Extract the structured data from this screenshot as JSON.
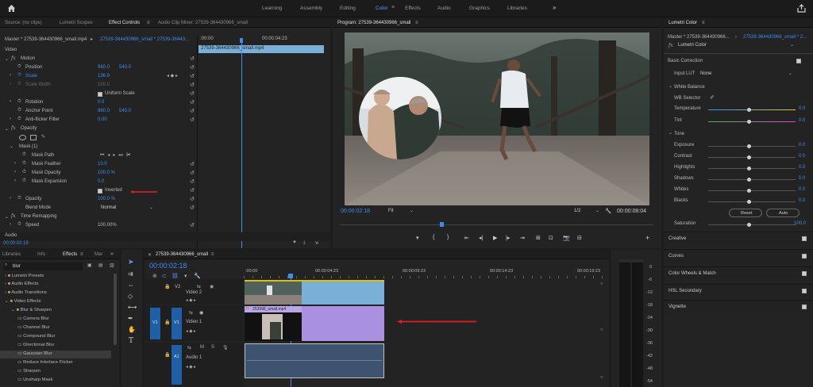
{
  "workspaces": [
    "Learning",
    "Assembly",
    "Editing",
    "Color",
    "Effects",
    "Audio",
    "Graphics",
    "Libraries"
  ],
  "active_workspace": "Color",
  "source_tabs": {
    "source": "Source: (no clips)",
    "lumetri_scopes": "Lumetri Scopes",
    "effect_controls": "Effect Controls",
    "audio_mixer": "Audio Clip Mixer: 27539-364430966_small"
  },
  "effect_controls": {
    "master": "Master * 27539-364430966_small.mp4",
    "clip": "27539-364430966_small * 27539-36443...",
    "ruler_start": ":00:00",
    "ruler_end": "00:00:04:23",
    "clip_bar": "27539-364430966_small.mp4",
    "video_label": "Video",
    "motion": "Motion",
    "position": {
      "label": "Position",
      "x": "960.0",
      "y": "540.0"
    },
    "scale": {
      "label": "Scale",
      "value": "136.9"
    },
    "scale_width": {
      "label": "Scale Width",
      "value": "100.0"
    },
    "uniform_scale": "Uniform Scale",
    "rotation": {
      "label": "Rotation",
      "value": "0.0"
    },
    "anchor": {
      "label": "Anchor Point",
      "x": "960.0",
      "y": "540.0"
    },
    "anti_flicker": {
      "label": "Anti-flicker Filter",
      "value": "0.00"
    },
    "opacity": "Opacity",
    "mask": "Mask (1)",
    "mask_path": "Mask Path",
    "mask_feather": {
      "label": "Mask Feather",
      "value": "10.0"
    },
    "mask_opacity": {
      "label": "Mask Opacity",
      "value": "100.0 %"
    },
    "mask_expansion": {
      "label": "Mask Expansion",
      "value": "0.0"
    },
    "inverted": "Inverted",
    "opacity_val": {
      "label": "Opacity",
      "value": "100.0 %"
    },
    "blend": {
      "label": "Blend Mode",
      "value": "Normal"
    },
    "time_remap": "Time Remapping",
    "speed": {
      "label": "Speed",
      "value": "100.00%"
    },
    "audio": "Audio",
    "timecode": "00:00:02:18"
  },
  "program": {
    "title": "Program: 27539-364430966_small",
    "timecode": "00:00:02:18",
    "fit": "Fit",
    "res": "1/2",
    "duration": "00:00:08:04"
  },
  "lumetri": {
    "title": "Lumetri Color",
    "master": "Master * 27539-364430966...",
    "clip": "27539-364430966_small * 2...",
    "fx": "Lumetri Color",
    "basic": "Basic Correction",
    "input_lut": {
      "label": "Input LUT",
      "value": "None"
    },
    "wb": "White Balance",
    "wb_selector": "WB Selector",
    "temperature": {
      "label": "Temperature",
      "value": "0.0"
    },
    "tint": {
      "label": "Tint",
      "value": "0.0"
    },
    "tone": "Tone",
    "tone_rows": [
      {
        "label": "Exposure",
        "value": "0.0"
      },
      {
        "label": "Contrast",
        "value": "0.0"
      },
      {
        "label": "Highlights",
        "value": "0.0"
      },
      {
        "label": "Shadows",
        "value": "0.0"
      },
      {
        "label": "Whites",
        "value": "0.0"
      },
      {
        "label": "Blacks",
        "value": "0.0"
      }
    ],
    "reset": "Reset",
    "auto": "Auto",
    "saturation": {
      "label": "Saturation",
      "value": "100.0"
    },
    "sections": [
      "Creative",
      "Curves",
      "Color Wheels & Match",
      "HSL Secondary",
      "Vignette"
    ]
  },
  "effects_panel": {
    "tabs": [
      "Libraries",
      "Info",
      "Effects",
      "Mar"
    ],
    "search": "blur",
    "tree": [
      {
        "label": "Lumetri Presets",
        "depth": 0
      },
      {
        "label": "Audio Effects",
        "depth": 0
      },
      {
        "label": "Audio Transitions",
        "depth": 0
      },
      {
        "label": "Video Effects",
        "depth": 0
      },
      {
        "label": "Blur & Sharpen",
        "depth": 1
      },
      {
        "label": "Camera Blur",
        "depth": 2
      },
      {
        "label": "Channel Blur",
        "depth": 2
      },
      {
        "label": "Compound Blur",
        "depth": 2
      },
      {
        "label": "Directional Blur",
        "depth": 2
      },
      {
        "label": "Gaussian Blur",
        "depth": 2
      },
      {
        "label": "Reduce Interlace Flicker",
        "depth": 2
      },
      {
        "label": "Sharpen",
        "depth": 2
      },
      {
        "label": "Unsharp Mask",
        "depth": 2
      },
      {
        "label": "Unsharp Mask",
        "depth": 2
      }
    ]
  },
  "timeline": {
    "title": "27539-364430966_small",
    "timecode": "00:00:02:18",
    "ruler": [
      ":00:00",
      "00:00:04:23",
      "00:00:09:23",
      "00:00:14:23",
      "00:00:19:23"
    ],
    "tracks": {
      "v2": "V2",
      "v1": "V1",
      "a1": "A1",
      "video2": "Video 2",
      "video1": "Video 1",
      "audio1": "Audio 1",
      "v1_src": "V1",
      "a1_src": "A1"
    },
    "clip_label": "253998_small.mp4"
  },
  "meter_labels": [
    "0",
    "-6",
    "-12",
    "-18",
    "-24",
    "-30",
    "-36",
    "-42",
    "-48",
    "-54"
  ],
  "colors": {
    "accent": "#3f8cf0",
    "clip_v2": "#7ab0d8",
    "clip_v1": "#a990e0",
    "clip_a1": "#3e5370",
    "arrow": "#e02020"
  }
}
